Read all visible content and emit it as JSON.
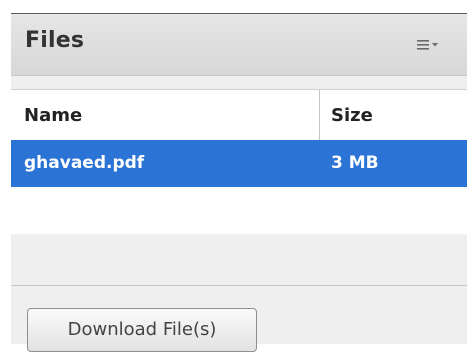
{
  "panel": {
    "title": "Files",
    "menu_icon": "list-menu-icon"
  },
  "table": {
    "columns": [
      "Name",
      "Size"
    ],
    "rows": [
      {
        "name": "ghavaed.pdf",
        "size": "3 MB",
        "selected": true
      }
    ]
  },
  "footer": {
    "download_label": "Download File(s)"
  },
  "colors": {
    "selection": "#2b73d4",
    "header_bg": "#dcdcdc",
    "panel_bg": "#efefef"
  }
}
